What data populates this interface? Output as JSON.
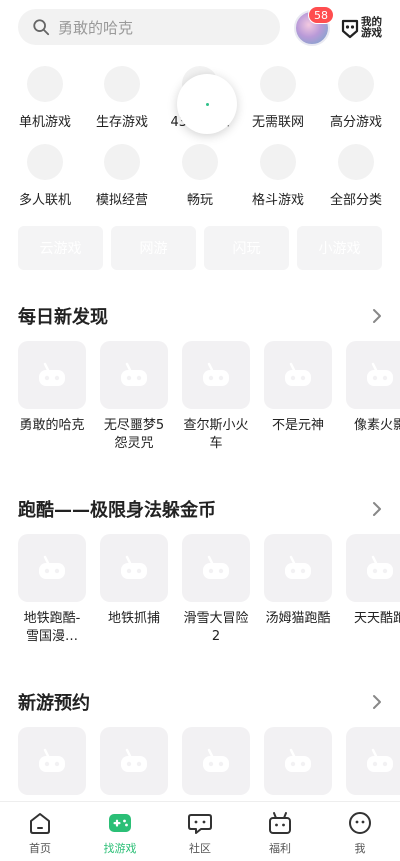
{
  "search": {
    "placeholder": "勇敢的哈克"
  },
  "header": {
    "badge_count": "58",
    "my_games_line1": "我的",
    "my_games_line2": "游戏"
  },
  "categories": [
    {
      "label": "单机游戏"
    },
    {
      "label": "生存游戏"
    },
    {
      "label": "4399独家"
    },
    {
      "label": "无需联网"
    },
    {
      "label": "高分游戏"
    },
    {
      "label": "多人联机"
    },
    {
      "label": "模拟经营"
    },
    {
      "label": "畅玩"
    },
    {
      "label": "格斗游戏"
    },
    {
      "label": "全部分类"
    }
  ],
  "chips": [
    {
      "label": "云游戏"
    },
    {
      "label": "网游"
    },
    {
      "label": "闪玩"
    },
    {
      "label": "小游戏"
    }
  ],
  "sections": [
    {
      "title": "每日新发现",
      "games": [
        {
          "name": "勇敢的哈克"
        },
        {
          "name": "无尽噩梦5怨灵咒"
        },
        {
          "name": "查尔斯小火车"
        },
        {
          "name": "不是元神"
        },
        {
          "name": "像素火影"
        }
      ]
    },
    {
      "title": "跑酷——极限身法躲金币",
      "games": [
        {
          "name": "地铁跑酷-雪国漫…"
        },
        {
          "name": "地铁抓捕"
        },
        {
          "name": "滑雪大冒险2"
        },
        {
          "name": "汤姆猫跑酷"
        },
        {
          "name": "天天酷跑"
        }
      ]
    },
    {
      "title": "新游预约",
      "games": [
        {
          "name": ""
        },
        {
          "name": ""
        },
        {
          "name": ""
        },
        {
          "name": ""
        },
        {
          "name": ""
        }
      ]
    }
  ],
  "nav": [
    {
      "label": "首页",
      "icon": "home-icon"
    },
    {
      "label": "找游戏",
      "icon": "gamepad-icon",
      "active": true
    },
    {
      "label": "社区",
      "icon": "chat-icon"
    },
    {
      "label": "福利",
      "icon": "gift-icon"
    },
    {
      "label": "我",
      "icon": "profile-icon"
    }
  ],
  "colors": {
    "accent": "#2bbf76",
    "badge": "#ff4d4f",
    "placeholder_bg": "#f2f2f2"
  }
}
